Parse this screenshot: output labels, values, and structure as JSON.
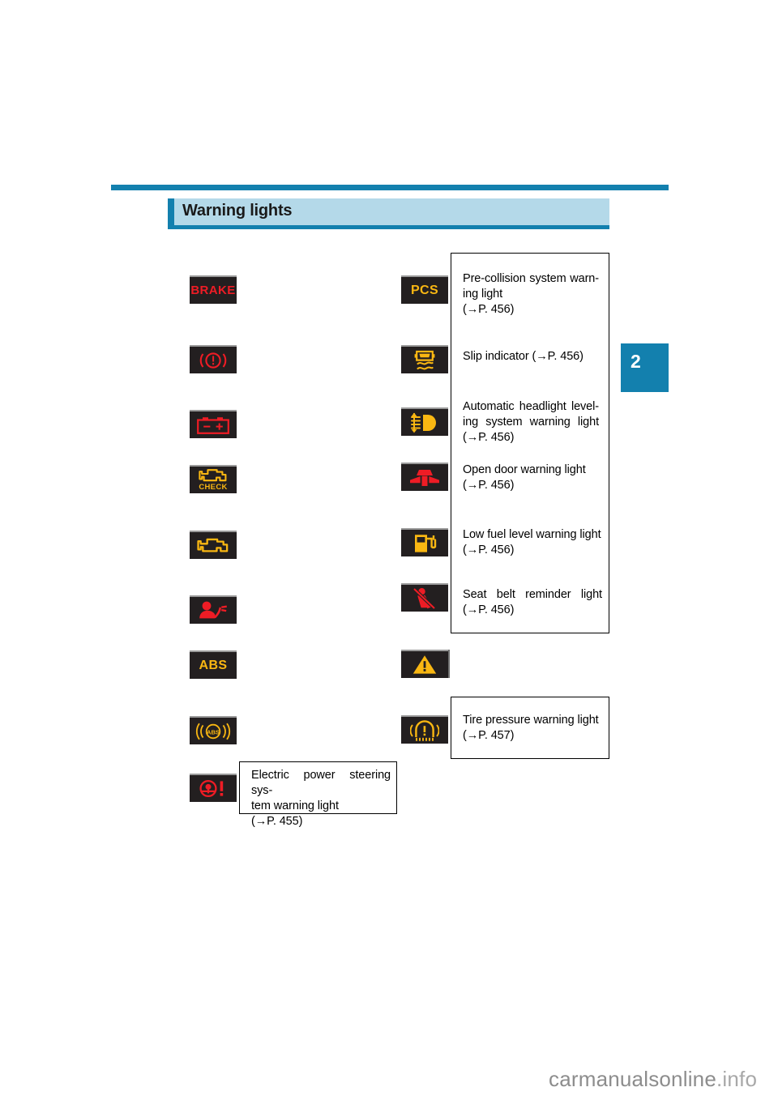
{
  "page": {
    "section_title": "Warning lights",
    "chapter_tab": "2",
    "watermark_main": "carmanualsonline",
    "watermark_tld": ".info"
  },
  "left_column": {
    "items": [
      {
        "id": "brake-text",
        "label": "BRAKE",
        "icon": "brake-text-warning-icon",
        "color": "#EE1C25"
      },
      {
        "id": "brake-system",
        "label": "",
        "icon": "brake-system-warning-icon",
        "color": "#EE1C25"
      },
      {
        "id": "charging-system",
        "label": "",
        "icon": "battery-charging-warning-icon",
        "color": "#EE1C25"
      },
      {
        "id": "check-engine",
        "label": "CHECK",
        "icon": "check-engine-warning-icon",
        "color": "#F9B712"
      },
      {
        "id": "malfunction-indicator",
        "label": "",
        "icon": "engine-malfunction-warning-icon",
        "color": "#F9B712"
      },
      {
        "id": "srs-airbag",
        "label": "",
        "icon": "srs-airbag-warning-icon",
        "color": "#EE1C25"
      },
      {
        "id": "abs",
        "label": "ABS",
        "icon": "abs-warning-icon",
        "color": "#F9B712"
      },
      {
        "id": "brake-assist",
        "label": "ABS",
        "icon": "abs-brake-assist-warning-icon",
        "color": "#F9B712"
      },
      {
        "id": "eps",
        "label": "",
        "icon": "electric-power-steering-warning-icon",
        "color": "#EE1C25"
      }
    ]
  },
  "right_column": {
    "items": [
      {
        "id": "pcs",
        "label": "PCS",
        "icon": "pre-collision-system-warning-icon",
        "color": "#F9B712"
      },
      {
        "id": "slip-indicator",
        "label": "",
        "icon": "slip-indicator-icon",
        "color": "#F9B712"
      },
      {
        "id": "headlight-level",
        "label": "",
        "icon": "auto-headlight-leveling-warning-icon",
        "color": "#F9B712"
      },
      {
        "id": "open-door",
        "label": "",
        "icon": "open-door-warning-icon",
        "color": "#EE1C25"
      },
      {
        "id": "low-fuel",
        "label": "",
        "icon": "low-fuel-level-warning-icon",
        "color": "#F9B712"
      },
      {
        "id": "seat-belt",
        "label": "",
        "icon": "seat-belt-reminder-icon",
        "color": "#EE1C25"
      },
      {
        "id": "master-warning",
        "label": "",
        "icon": "master-warning-triangle-icon",
        "color": "#F9B712"
      },
      {
        "id": "tire-pressure",
        "label": "",
        "icon": "tire-pressure-warning-icon",
        "color": "#F9B712"
      }
    ]
  },
  "callouts": {
    "right_box": {
      "rows": [
        {
          "id": "pcs-desc",
          "line1": "Pre-collision system warn-",
          "line2": "ing light",
          "line3": "(→P. 456)",
          "justify1": true,
          "justify2": false
        },
        {
          "id": "slip-desc",
          "line1": "Slip indicator (→P. 456)",
          "line2": "",
          "line3": "",
          "justify1": false,
          "justify2": false
        },
        {
          "id": "headlight-level-desc",
          "line1": "Automatic headlight level-",
          "line2": "ing system warning light",
          "line3": "(→P. 456)",
          "justify1": true,
          "justify2": true
        },
        {
          "id": "open-door-desc",
          "line1": "Open door warning light",
          "line2": "(→P. 456)",
          "line3": "",
          "justify1": false,
          "justify2": false
        },
        {
          "id": "low-fuel-desc",
          "line1": "Low fuel level warning light",
          "line2": "(→P. 456)",
          "line3": "",
          "justify1": false,
          "justify2": false
        },
        {
          "id": "seat-belt-desc",
          "line1": "Seat belt reminder light",
          "line2": "(→P. 456)",
          "line3": "",
          "justify1": true,
          "justify2": false
        }
      ]
    },
    "tire_box": {
      "line1": "Tire pressure warning light",
      "line2": "(→P. 457)"
    },
    "eps_box": {
      "line1": "Electric power steering sys-",
      "line2": "tem warning light",
      "line3": "(→P. 455)"
    }
  }
}
